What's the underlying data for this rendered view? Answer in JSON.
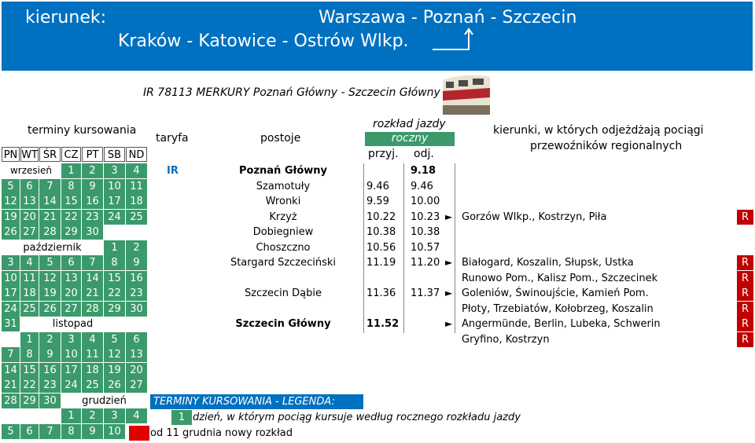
{
  "banner": {
    "label": "kierunek:",
    "route1": "Warszawa - Poznań - Szczecin",
    "route2": "Kraków - Katowice - Ostrów Wlkp."
  },
  "train_title": "IR 78113 MERKURY Poznań Główny - Szczecin Główny",
  "headers": {
    "terminy": "terminy kursowania",
    "taryfa": "taryfa",
    "postoje": "postoje",
    "rozklad": "rozkład jazdy",
    "roczny": "roczny",
    "przyj": "przyj.",
    "odj": "odj.",
    "kierunki1": "kierunki, w których odjeżdżają pociągi",
    "kierunki2": "przewoźników regionalnych",
    "days": [
      "PN",
      "WT",
      "ŚR",
      "CZ",
      "PT",
      "SB",
      "ND"
    ]
  },
  "calendar": {
    "wrzesien": "wrzesień",
    "pazdziernik": "październik",
    "listopad": "listopad",
    "grudzien": "grudzień",
    "rows": [
      [
        "",
        "",
        "",
        "1",
        "2",
        "3",
        "4"
      ],
      [
        "5",
        "6",
        "7",
        "8",
        "9",
        "10",
        "11"
      ],
      [
        "12",
        "13",
        "14",
        "15",
        "16",
        "17",
        "18"
      ],
      [
        "19",
        "20",
        "21",
        "22",
        "23",
        "24",
        "25"
      ],
      [
        "26",
        "27",
        "28",
        "29",
        "30",
        "",
        ""
      ],
      [
        "",
        "",
        "",
        "",
        "",
        "1",
        "2"
      ],
      [
        "3",
        "4",
        "5",
        "6",
        "7",
        "8",
        "9"
      ],
      [
        "10",
        "11",
        "12",
        "13",
        "14",
        "15",
        "16"
      ],
      [
        "17",
        "18",
        "19",
        "20",
        "21",
        "22",
        "23"
      ],
      [
        "24",
        "25",
        "26",
        "27",
        "28",
        "29",
        "30"
      ],
      [
        "31",
        "",
        "",
        "",
        "",
        "",
        ""
      ],
      [
        "",
        "1",
        "2",
        "3",
        "4",
        "5",
        "6"
      ],
      [
        "7",
        "8",
        "9",
        "10",
        "11",
        "12",
        "13"
      ],
      [
        "14",
        "15",
        "16",
        "17",
        "18",
        "19",
        "20"
      ],
      [
        "21",
        "22",
        "23",
        "24",
        "25",
        "26",
        "27"
      ],
      [
        "28",
        "29",
        "30",
        "",
        "",
        "",
        ""
      ],
      [
        "",
        "",
        "",
        "1",
        "2",
        "3",
        "4"
      ],
      [
        "5",
        "6",
        "7",
        "8",
        "9",
        "10",
        ""
      ]
    ]
  },
  "tariff": "IR",
  "stops": [
    {
      "name": "Poznań Główny",
      "arr": "",
      "dep": "9.18",
      "bold": true
    },
    {
      "name": "Szamotuły",
      "arr": "9.46",
      "dep": "9.46"
    },
    {
      "name": "Wronki",
      "arr": "9.59",
      "dep": "10.00"
    },
    {
      "name": "Krzyż",
      "arr": "10.22",
      "dep": "10.23"
    },
    {
      "name": "Dobiegniew",
      "arr": "10.38",
      "dep": "10.38"
    },
    {
      "name": "Choszczno",
      "arr": "10.56",
      "dep": "10.57"
    },
    {
      "name": "Stargard Szczeciński",
      "arr": "11.19",
      "dep": "11.20"
    },
    {
      "name": "",
      "arr": "",
      "dep": ""
    },
    {
      "name": "Szczecin Dąbie",
      "arr": "11.36",
      "dep": "11.37"
    },
    {
      "name": "",
      "arr": "",
      "dep": ""
    },
    {
      "name": "Szczecin Główny",
      "arr": "11.52",
      "dep": "",
      "bold": true
    }
  ],
  "connections": [
    {
      "row": 3,
      "text": "Gorzów Wlkp., Kostrzyn, Piła",
      "arrow": true
    },
    {
      "row": 6,
      "text": "Białogard, Koszalin, Słupsk, Ustka",
      "arrow": true
    },
    {
      "row": 7,
      "text": "Runowo Pom., Kalisz Pom., Szczecinek",
      "arrow": false
    },
    {
      "row": 8,
      "text": "Goleniów, Świnoujście, Kamień Pom.",
      "arrow": true
    },
    {
      "row": 9,
      "text": "Płoty, Trzebiatów, Kołobrzeg, Koszalin",
      "arrow": false
    },
    {
      "row": 10,
      "text": "Angermünde, Berlin, Lubeka, Schwerin",
      "arrow": true
    },
    {
      "row": 11,
      "text": "Gryfino, Kostrzyn",
      "arrow": false
    }
  ],
  "r_label": "R",
  "legend": {
    "title": "TERMINY KURSOWANIA - LEGENDA:",
    "sample": "1",
    "desc1": "dzień, w którym pociąg kursuje według rocznego rozkładu jazdy",
    "desc2": "od 11 grudnia nowy rozkład"
  },
  "colors": {
    "banner": "#0070c0",
    "green": "#3b9a6b",
    "red": "#c00000"
  }
}
